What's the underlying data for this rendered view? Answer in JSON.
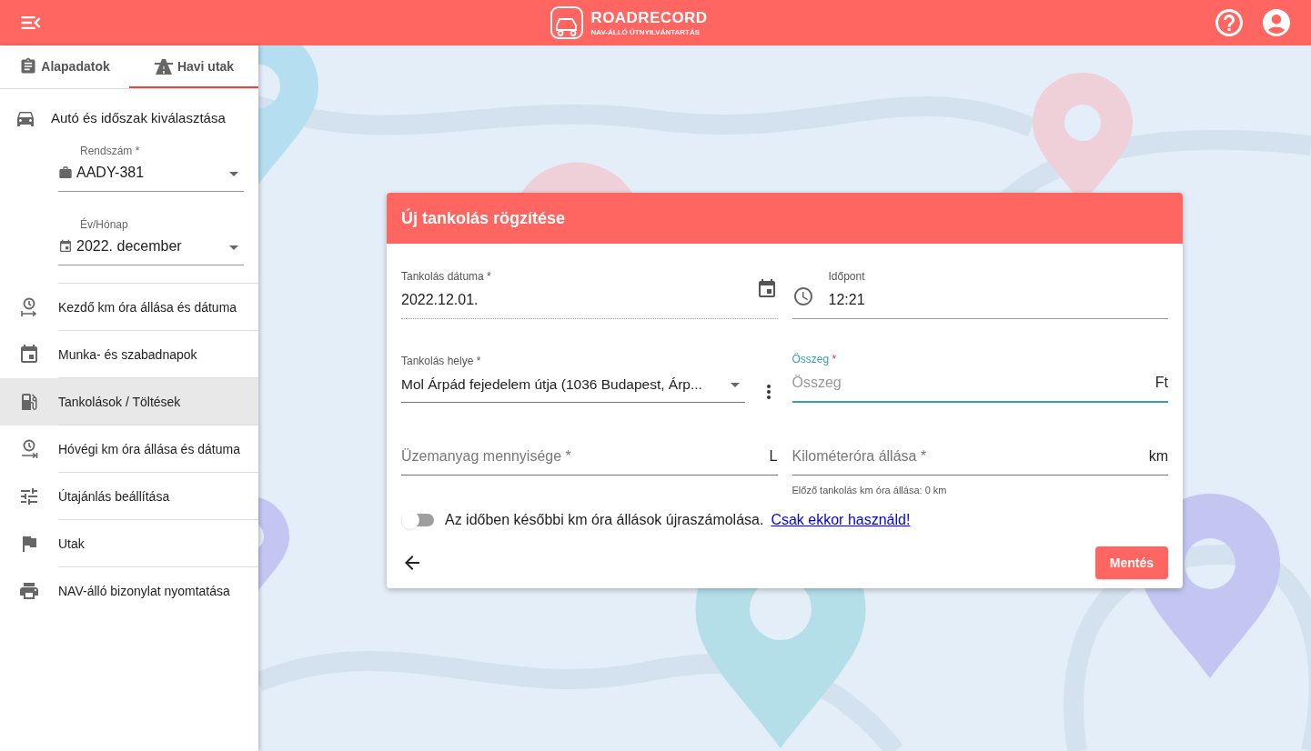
{
  "header": {
    "brand": "ROADRECORD",
    "tagline": "NAV-ÁLLÓ ÚTNYILVÁNTARTÁS"
  },
  "sidebar": {
    "tabs": [
      {
        "label": "Alapadatok",
        "selected": false
      },
      {
        "label": "Havi utak",
        "selected": true
      }
    ],
    "section_title": "Autó és időszak kiválasztása",
    "plate": {
      "label": "Rendszám *",
      "value": "AADY-381"
    },
    "period": {
      "label": "Év/Hónap",
      "value": "2022. december"
    },
    "items": [
      {
        "label": "Kezdő km óra állása és dátuma",
        "selected": false
      },
      {
        "label": "Munka- és szabadnapok",
        "selected": false
      },
      {
        "label": "Tankolások / Töltések",
        "selected": true
      },
      {
        "label": "Hóvégi km óra állása és dátuma",
        "selected": false
      },
      {
        "label": "Útajánlás beállítása",
        "selected": false
      },
      {
        "label": "Utak",
        "selected": false
      },
      {
        "label": "NAV-álló bizonylat nyomtatása",
        "selected": false
      }
    ]
  },
  "dialog": {
    "title": "Új tankolás rögzítése",
    "date": {
      "label": "Tankolás dátuma *",
      "value": "2022.12.01."
    },
    "time": {
      "label": "Időpont",
      "value": "12:21"
    },
    "place": {
      "label": "Tankolás helye *",
      "value": "Mol Árpád fejedelem útja (1036 Budapest, Árp..."
    },
    "amount": {
      "label": "Összeg",
      "required_mark": "*",
      "placeholder": "Összeg",
      "suffix": "Ft",
      "focused": true
    },
    "fuel": {
      "placeholder": "Üzemanyag mennyisége *",
      "suffix": "L"
    },
    "odometer": {
      "placeholder": "Kilométeróra állása *",
      "suffix": "km",
      "helper": "Előző tankolás km óra állása: 0 km"
    },
    "toggle": {
      "on": false,
      "text": "Az időben későbbi km óra állások újraszámolása.",
      "link": "Csak ekkor használd!"
    },
    "save_button": "Mentés"
  }
}
